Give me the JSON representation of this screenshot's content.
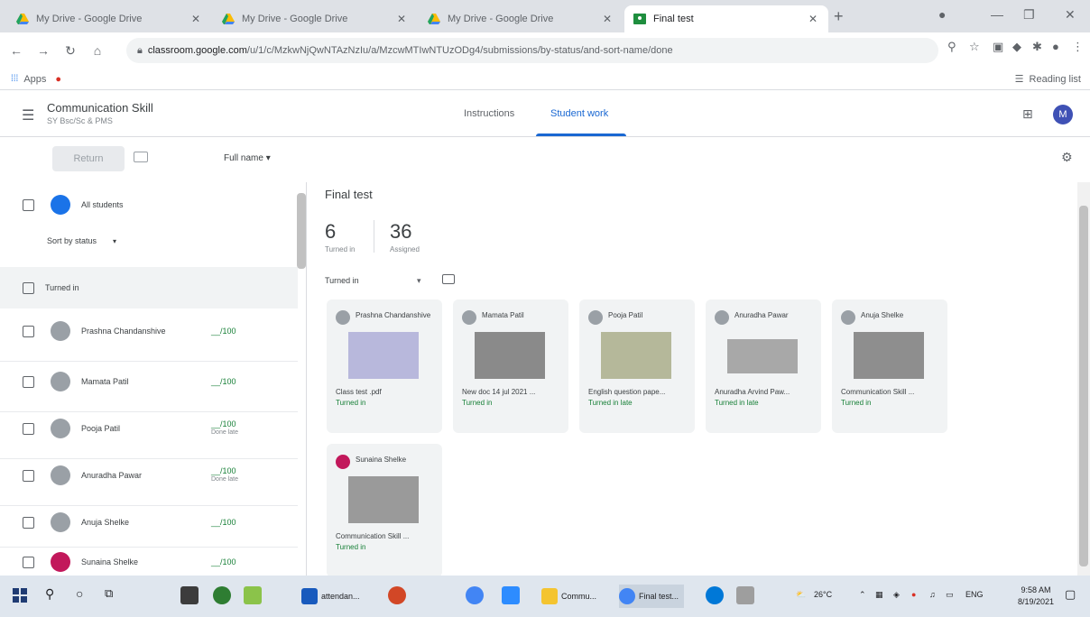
{
  "browser": {
    "tabs": [
      {
        "title": "My Drive - Google Drive",
        "icon": "drive-icon",
        "active": false
      },
      {
        "title": "My Drive - Google Drive",
        "icon": "drive-icon",
        "active": false
      },
      {
        "title": "My Drive - Google Drive",
        "icon": "drive-icon",
        "active": false
      },
      {
        "title": "Final test",
        "icon": "classroom-icon",
        "active": true
      }
    ],
    "url_host": "classroom.google.com",
    "url_path": "/u/1/c/MzkwNjQwNTAzNzIu/a/MzcwMTIwNTUzODg4/submissions/by-status/and-sort-name/done",
    "bookmarks": {
      "apps_label": "Apps",
      "reading_list": "Reading list"
    }
  },
  "classroom": {
    "course_title": "Communication Skill",
    "course_subtitle": "SY Bsc/Sc & PMS",
    "tabs": [
      "Instructions",
      "Student work"
    ],
    "active_tab": "Student work",
    "user_initial": "M"
  },
  "toolbar": {
    "return_label": "Return",
    "sort_label": "Full name"
  },
  "left_panel": {
    "all_students_label": "All students",
    "sort_label": "Sort by status",
    "section_label": "Turned in",
    "students": [
      {
        "name": "Prashna Chandanshive",
        "grade": "__/100",
        "note": ""
      },
      {
        "name": "Mamata Patil",
        "grade": "__/100",
        "note": ""
      },
      {
        "name": "Pooja Patil",
        "grade": "__/100",
        "note": "Done late"
      },
      {
        "name": "Anuradha Pawar",
        "grade": "__/100",
        "note": "Done late"
      },
      {
        "name": "Anuja Shelke",
        "grade": "__/100",
        "note": ""
      },
      {
        "name": "Sunaina Shelke",
        "grade": "__/100",
        "note": ""
      }
    ]
  },
  "main": {
    "assignment_title": "Final test",
    "turned_in_count": "6",
    "turned_in_label": "Turned in",
    "assigned_count": "36",
    "assigned_label": "Assigned",
    "filter_label": "Turned in",
    "cards": [
      {
        "name": "Prashna Chandanshive",
        "file": "Class test .pdf",
        "status": "Turned in",
        "thumb": "#b8b8dc"
      },
      {
        "name": "Mamata Patil",
        "file": "New doc 14 jul 2021 ...",
        "status": "Turned in",
        "thumb": "#8a8a8a"
      },
      {
        "name": "Pooja Patil",
        "file": "English question pape...",
        "status": "Turned in late",
        "thumb": "#b5b89a"
      },
      {
        "name": "Anuradha Pawar",
        "file": "Anuradha Arvind Paw...",
        "status": "Turned in late",
        "thumb": "#a8a8a8"
      },
      {
        "name": "Anuja Shelke",
        "file": "Communication Skill ...",
        "status": "Turned in",
        "thumb": "#8e8e8e"
      },
      {
        "name": "Sunaina Shelke",
        "file": "Communication Skill ...",
        "status": "Turned in",
        "thumb": "#9a9a9a"
      }
    ]
  },
  "taskbar": {
    "apps": [
      "attendan...",
      "Commu...",
      "Final test..."
    ],
    "weather": "26°C",
    "lang": "ENG",
    "time": "9:58 AM",
    "date": "8/19/2021"
  },
  "colors": {
    "accent": "#1967d2",
    "success": "#188038"
  }
}
